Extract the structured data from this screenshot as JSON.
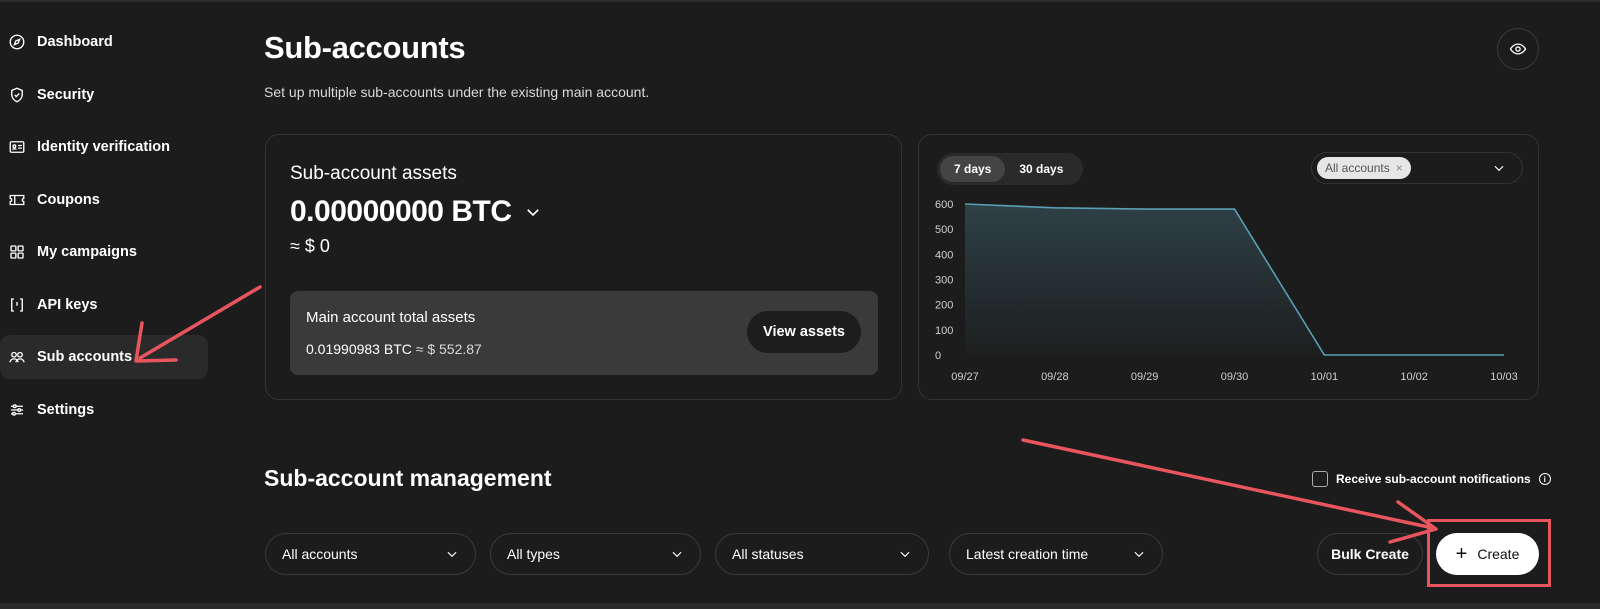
{
  "sidebar": {
    "items": [
      {
        "label": "Dashboard",
        "icon": "compass-icon"
      },
      {
        "label": "Security",
        "icon": "shield-icon"
      },
      {
        "label": "Identity verification",
        "icon": "id-card-icon"
      },
      {
        "label": "Coupons",
        "icon": "ticket-icon"
      },
      {
        "label": "My campaigns",
        "icon": "grid-icon"
      },
      {
        "label": "API keys",
        "icon": "bracket-icon"
      },
      {
        "label": "Sub accounts",
        "icon": "users-icon",
        "active": true
      },
      {
        "label": "Settings",
        "icon": "sliders-icon"
      }
    ]
  },
  "header": {
    "title": "Sub-accounts",
    "subtitle": "Set up multiple sub-accounts under the existing main account.",
    "visibility_icon": "eye-icon"
  },
  "assets": {
    "label": "Sub-account assets",
    "value": "0.00000000 BTC",
    "usd": "≈ $ 0",
    "main_label": "Main account total assets",
    "main_btc": "0.01990983 BTC",
    "main_usd": "≈ $ 552.87",
    "view_button": "View assets"
  },
  "chart_panel": {
    "range_tabs": [
      "7 days",
      "30 days"
    ],
    "active_range": "7 days",
    "account_chip": "All accounts",
    "chip_close": "×"
  },
  "chart_data": {
    "type": "area",
    "x": [
      "09/27",
      "09/28",
      "09/29",
      "09/30",
      "10/01",
      "10/02",
      "10/03"
    ],
    "values": [
      600,
      585,
      580,
      580,
      0,
      0,
      0
    ],
    "yticks": [
      0,
      100,
      200,
      300,
      400,
      500,
      600
    ],
    "ylim": [
      0,
      600
    ],
    "grid": false,
    "line_color": "#5a9fb5"
  },
  "management": {
    "title": "Sub-account management",
    "notify_label": "Receive sub-account notifications",
    "info_glyph": "i",
    "filters": [
      "All accounts",
      "All types",
      "All statuses",
      "Latest creation time"
    ],
    "bulk_button": "Bulk Create",
    "create_button": "Create",
    "create_plus": "+"
  },
  "colors": {
    "background": "#1c1c1c",
    "annotation": "#e8555e"
  }
}
